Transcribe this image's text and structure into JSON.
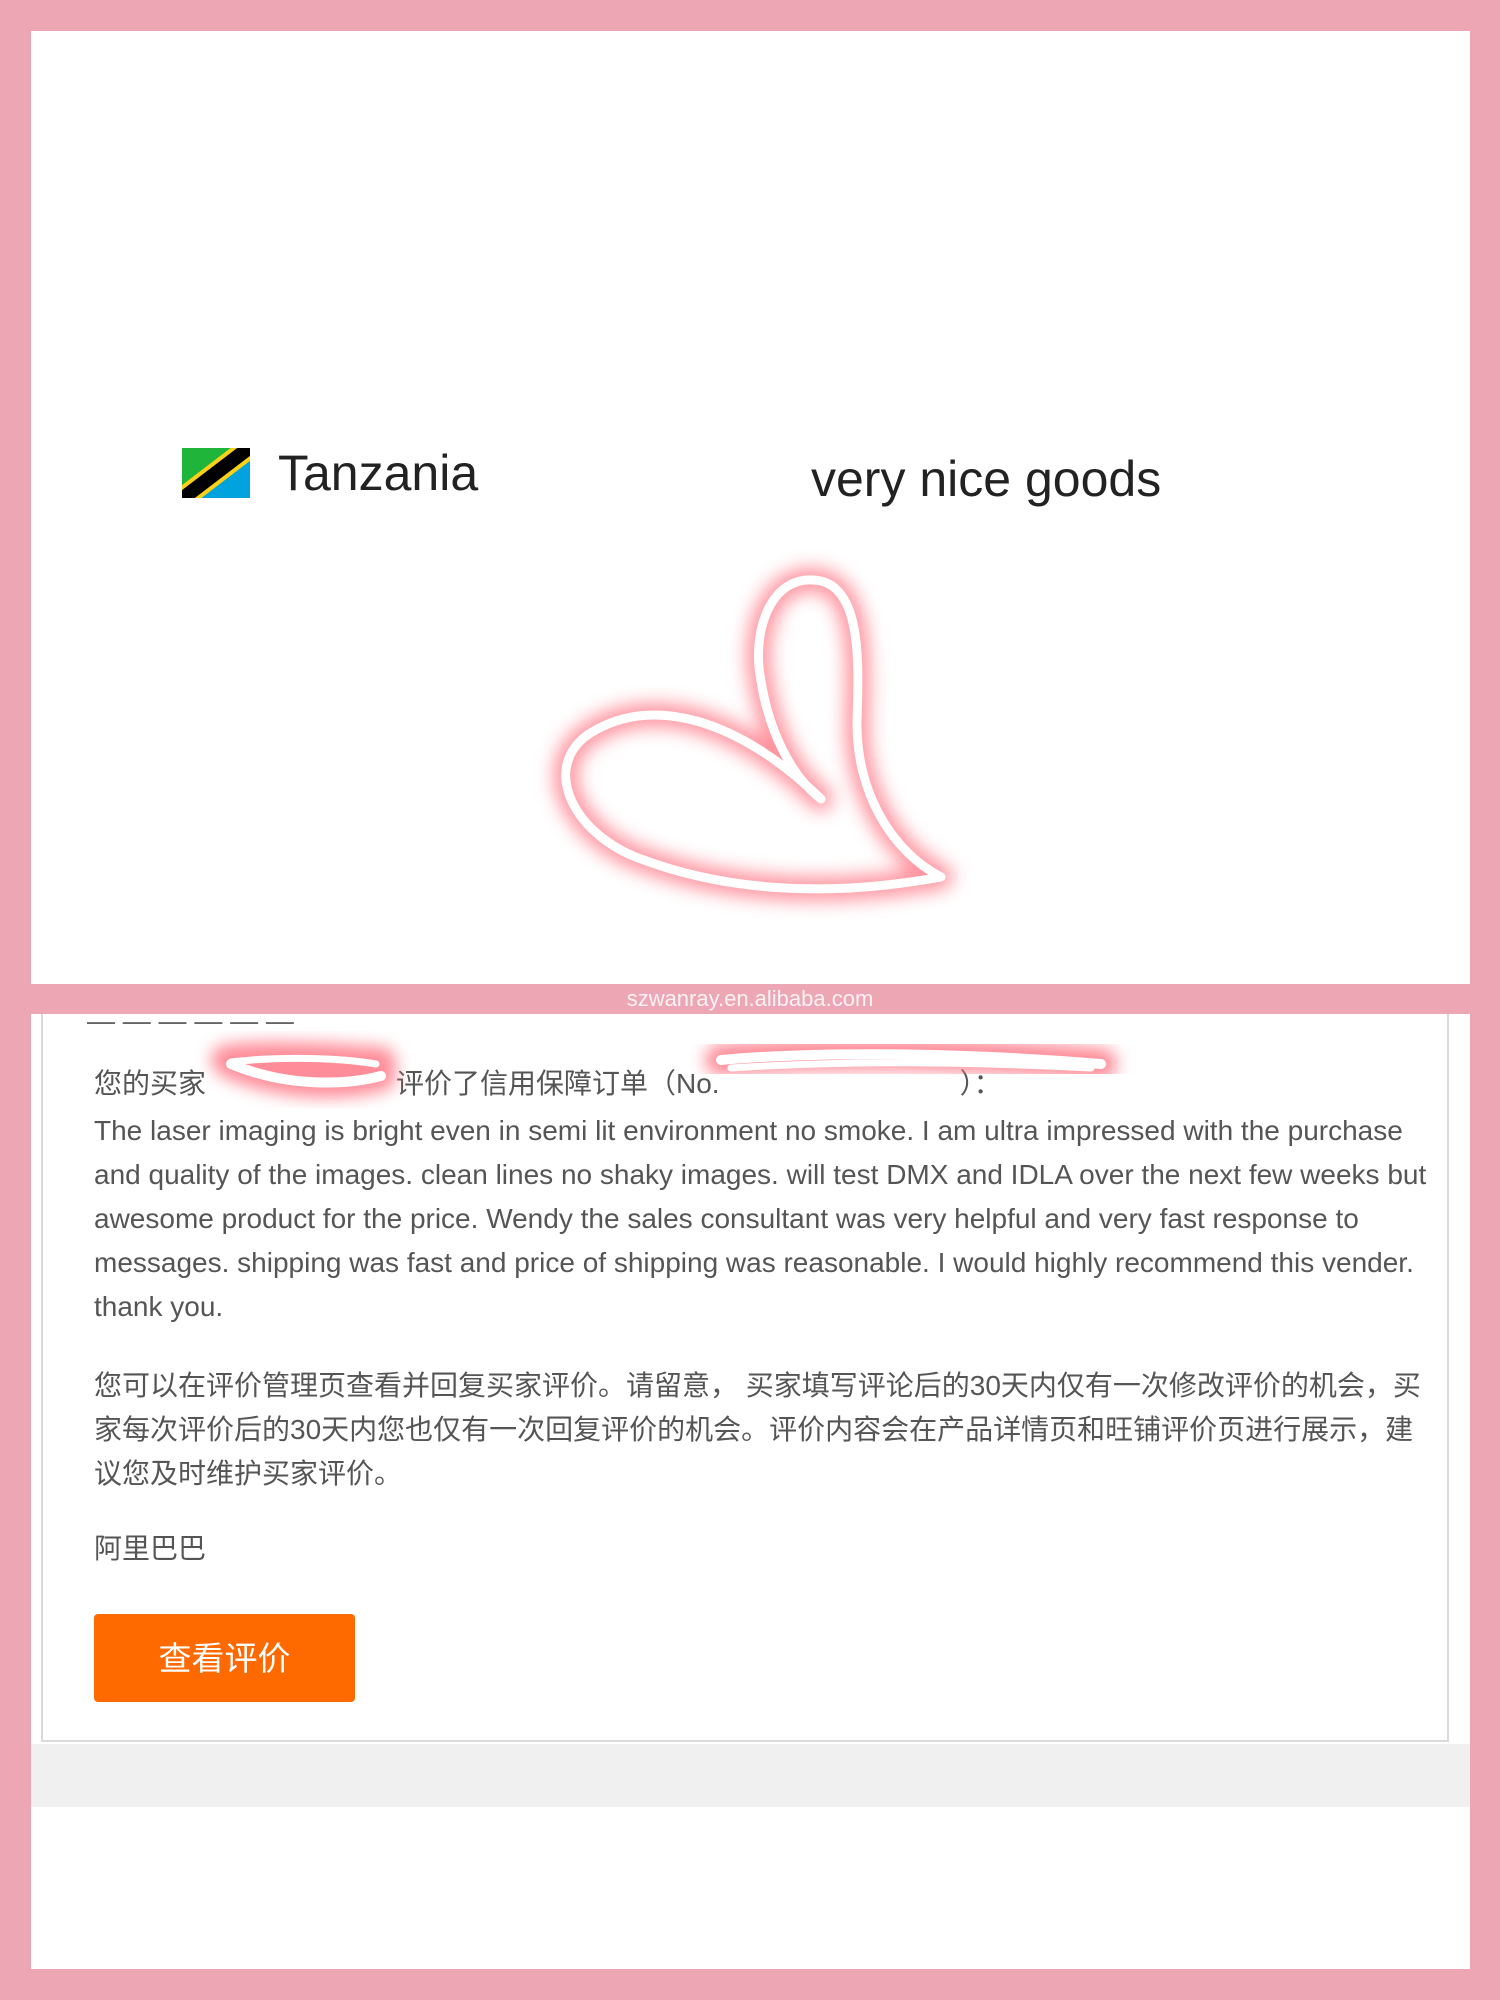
{
  "header": {
    "country": "Tanzania",
    "tagline": "very nice goods"
  },
  "watermark": "szwanray.en.alibaba.com",
  "email": {
    "cut_off_line": "— — — — —   —",
    "notice_prefix": "您的买家",
    "notice_middle": "评价了信用保障订单（No.",
    "notice_suffix": "）：",
    "review_text": "The laser imaging is bright even in semi lit environment no smoke. I am ultra impressed with the purchase and quality of the images. clean lines no shaky images. will test DMX and IDLA over the next few weeks but awesome product for the price. Wendy the sales consultant was very helpful and very fast response to messages. shipping was fast and price of shipping was reasonable. I would highly recommend this vender. thank you.",
    "advice_text": "您可以在评价管理页查看并回复买家评价。请留意， 买家填写评论后的30天内仅有一次修改评价的机会，买家每次评价后的30天内您也仅有一次回复评价的机会。评价内容会在产品详情页和旺铺评价页进行展示，建议您及时维护买家评价。",
    "signature": "阿里巴巴",
    "button_label": "查看评价"
  },
  "icons": {
    "flag": "tanzania-flag-icon",
    "heart": "hand-drawn-heart-icon"
  },
  "colors": {
    "frame": "#eda7b4",
    "button": "#ff6a00",
    "text": "#555555",
    "heart_glow": "#ff6f7f"
  }
}
